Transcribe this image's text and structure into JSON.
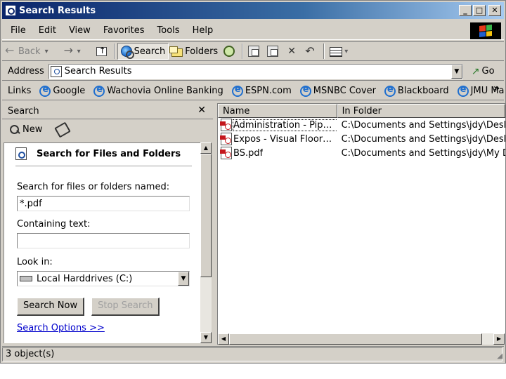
{
  "window": {
    "title": "Search Results",
    "controls": {
      "minimize": "_",
      "maximize": "□",
      "close": "✕"
    }
  },
  "menu": {
    "items": [
      "File",
      "Edit",
      "View",
      "Favorites",
      "Tools",
      "Help"
    ]
  },
  "toolbar": {
    "back_label": "Back",
    "search_label": "Search",
    "folders_label": "Folders",
    "icons": [
      "back-arrow-icon",
      "forward-arrow-icon",
      "up-folder-icon",
      "search-globe-icon",
      "folders-icon",
      "history-icon",
      "move-to-icon",
      "copy-to-icon",
      "delete-icon",
      "undo-icon",
      "views-icon"
    ]
  },
  "address": {
    "label": "Address",
    "value": "Search Results",
    "go_label": "Go"
  },
  "links": {
    "label": "Links",
    "items": [
      "Google",
      "Wachovia Online Banking",
      "ESPN.com",
      "MSNBC Cover",
      "Blackboard",
      "JMU Mail"
    ],
    "more": "»"
  },
  "search_pane": {
    "header": "Search",
    "close": "✕",
    "new_label": "New",
    "title": "Search for Files and Folders",
    "named_label": "Search for files or folders named:",
    "named_value": "*.pdf",
    "containing_label": "Containing text:",
    "containing_value": "",
    "lookin_label": "Look in:",
    "lookin_value": "Local Harddrives (C:)",
    "search_now_label": "Search Now",
    "stop_search_label": "Stop Search",
    "options_label": "Search Options >>"
  },
  "results": {
    "columns": [
      "Name",
      "In Folder"
    ],
    "rows": [
      {
        "name": "Administration - Pipelin...",
        "folder": "C:\\Documents and Settings\\jdy\\Desktop"
      },
      {
        "name": "Expos - Visual Floorpla...",
        "folder": "C:\\Documents and Settings\\jdy\\Desktop"
      },
      {
        "name": "BS.pdf",
        "folder": "C:\\Documents and Settings\\jdy\\My Docu"
      }
    ]
  },
  "status": {
    "text": "3 object(s)"
  },
  "colors": {
    "title_bar": "#0a246a",
    "chrome": "#d4d0c8",
    "link": "#0000cc"
  }
}
